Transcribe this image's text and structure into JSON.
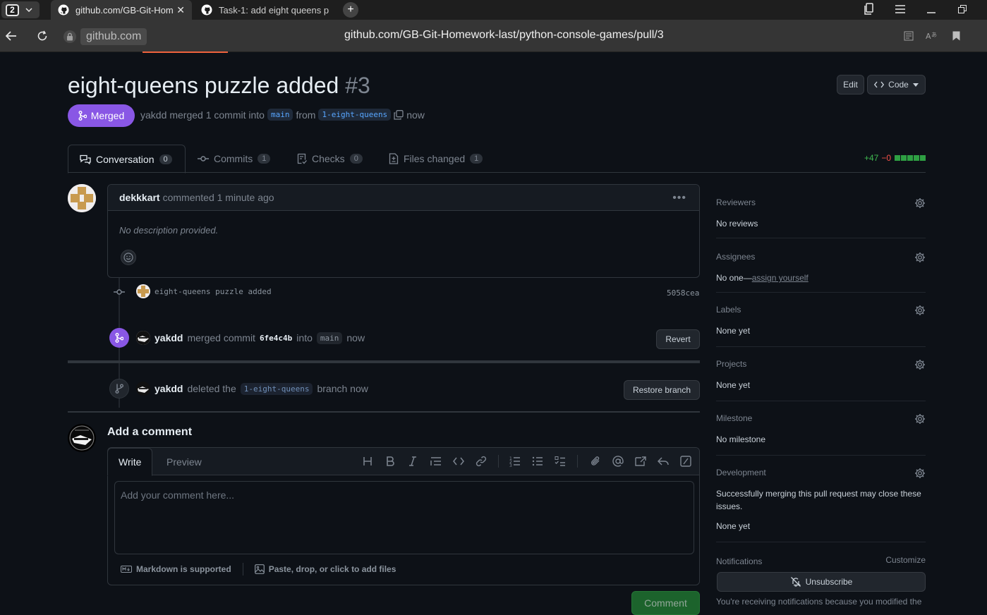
{
  "browser": {
    "tab_count": "2",
    "tabs": [
      {
        "title": "github.com/GB-Git-Hom"
      },
      {
        "title": "Task-1: add eight queens p"
      }
    ],
    "domain": "github.com",
    "url": "github.com/GB-Git-Homework-last/python-console-games/pull/3"
  },
  "pr": {
    "title": "eight-queens puzzle added",
    "number": "#3",
    "edit_label": "Edit",
    "code_label": "Code",
    "state": "Merged",
    "meta": {
      "author": "yakdd",
      "text": "merged 1 commit into",
      "base": "main",
      "from": "from",
      "head": "1-eight-queens",
      "when": "now"
    }
  },
  "tabs": [
    {
      "label": "Conversation",
      "count": "0"
    },
    {
      "label": "Commits",
      "count": "1"
    },
    {
      "label": "Checks",
      "count": "0"
    },
    {
      "label": "Files changed",
      "count": "1"
    }
  ],
  "diffstat": {
    "additions": "+47",
    "deletions": "−0"
  },
  "comment": {
    "author": "dekkkart",
    "action": "commented 1 minute ago",
    "body": "No description provided."
  },
  "commit": {
    "message": "eight-queens puzzle added",
    "sha": "5058cea"
  },
  "merge_event": {
    "actor": "yakdd",
    "text1": "merged commit",
    "sha": "6fe4c4b",
    "text2": "into",
    "branch": "main",
    "when": "now",
    "button": "Revert"
  },
  "delete_event": {
    "actor": "yakdd",
    "text1": "deleted the",
    "branch": "1-eight-queens",
    "text2": "branch now",
    "button": "Restore branch"
  },
  "add_comment": {
    "title": "Add a comment",
    "write_tab": "Write",
    "preview_tab": "Preview",
    "placeholder": "Add your comment here...",
    "markdown_note": "Markdown is supported",
    "files_note": "Paste, drop, or click to add files",
    "submit": "Comment"
  },
  "sidebar": {
    "reviewers": {
      "label": "Reviewers",
      "value": "No reviews"
    },
    "assignees": {
      "label": "Assignees",
      "value": "No one—",
      "link": "assign yourself"
    },
    "labels": {
      "label": "Labels",
      "value": "None yet"
    },
    "projects": {
      "label": "Projects",
      "value": "None yet"
    },
    "milestone": {
      "label": "Milestone",
      "value": "No milestone"
    },
    "development": {
      "label": "Development",
      "value": "Successfully merging this pull request may close these issues.",
      "value2": "None yet"
    },
    "notifications": {
      "label": "Notifications",
      "customize": "Customize",
      "button": "Unsubscribe",
      "note": "You're receiving notifications because you modified the"
    }
  },
  "colors": {
    "merged": "#8957e5",
    "accent_link": "#58a6ff",
    "add": "#3fb950",
    "del": "#f85149"
  }
}
